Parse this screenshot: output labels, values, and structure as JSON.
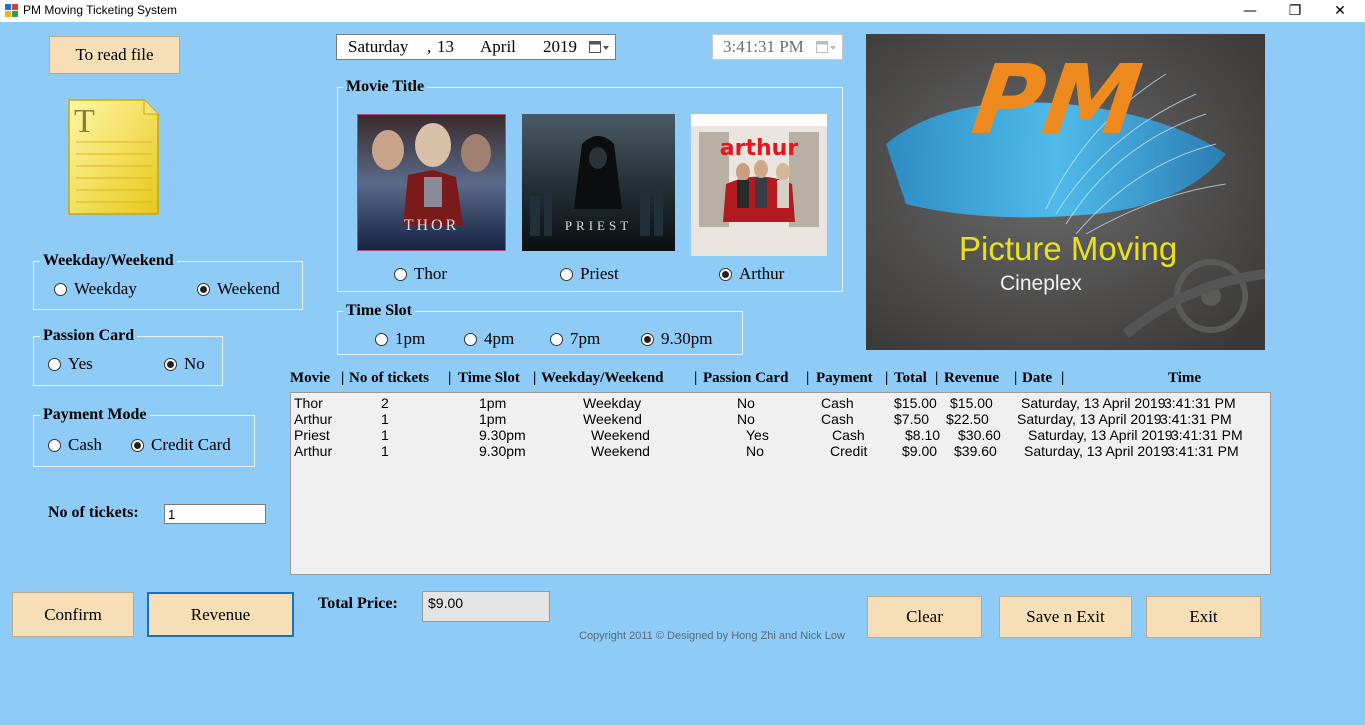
{
  "window": {
    "title": "PM Moving Ticketing System",
    "minimize": "—",
    "maximize": "❐",
    "close": "✕"
  },
  "read_file_button": "To read file",
  "date_picker": {
    "weekday": "Saturday",
    "sep": ",",
    "day": "13",
    "month": "April",
    "year": "2019"
  },
  "time_picker": {
    "value": "3:41:31 PM"
  },
  "movie_title": {
    "label": "Movie Title",
    "options": [
      {
        "label": "Thor",
        "selected": false,
        "poster_text": "THOR"
      },
      {
        "label": "Priest",
        "selected": false,
        "poster_text": "PRIEST"
      },
      {
        "label": "Arthur",
        "selected": true,
        "poster_text": "arthur"
      }
    ]
  },
  "logo": {
    "line1": "Picture Moving",
    "line2": "Cineplex",
    "letters": "PM"
  },
  "weekday_group": {
    "label": "Weekday/Weekend",
    "options": [
      {
        "label": "Weekday",
        "selected": false
      },
      {
        "label": "Weekend",
        "selected": true
      }
    ]
  },
  "passion_card_group": {
    "label": "Passion Card",
    "options": [
      {
        "label": "Yes",
        "selected": false
      },
      {
        "label": "No",
        "selected": true
      }
    ]
  },
  "payment_group": {
    "label": "Payment Mode",
    "options": [
      {
        "label": "Cash",
        "selected": false
      },
      {
        "label": "Credit Card",
        "selected": true
      }
    ]
  },
  "time_slot_group": {
    "label": "Time Slot",
    "options": [
      {
        "label": "1pm",
        "selected": false
      },
      {
        "label": "4pm",
        "selected": false
      },
      {
        "label": "7pm",
        "selected": false
      },
      {
        "label": "9.30pm",
        "selected": true
      }
    ]
  },
  "tickets": {
    "label": "No of tickets:",
    "value": "1"
  },
  "table": {
    "headers": [
      "Movie",
      "No of tickets",
      "Time Slot",
      "Weekday/Weekend",
      "Passion Card",
      "Payment",
      "Total",
      "Revenue",
      "Date",
      "Time"
    ],
    "separator": "|",
    "rows": [
      [
        "Thor",
        "2",
        "1pm",
        "Weekday",
        "No",
        "Cash",
        "$15.00",
        "$15.00",
        "Saturday, 13 April 2019",
        "3:41:31 PM"
      ],
      [
        "Arthur",
        "1",
        "1pm",
        "Weekend",
        "No",
        "Cash",
        "$7.50",
        "$22.50",
        "Saturday, 13 April 2019",
        "3:41:31 PM"
      ],
      [
        "Priest",
        "1",
        "9.30pm",
        "Weekend",
        "Yes",
        "Cash",
        "$8.10",
        "$30.60",
        "Saturday, 13 April 2019",
        "3:41:31 PM"
      ],
      [
        "Arthur",
        "1",
        "9.30pm",
        "Weekend",
        "No",
        "Credit",
        "$9.00",
        "$39.60",
        "Saturday, 13 April 2019",
        "3:41:31 PM"
      ]
    ]
  },
  "buttons": {
    "confirm": "Confirm",
    "revenue": "Revenue",
    "clear": "Clear",
    "save_exit": "Save n Exit",
    "exit": "Exit"
  },
  "total_price": {
    "label": "Total Price:",
    "value": "$9.00"
  },
  "copyright": "Copyright 2011 © Designed by Hong Zhi and Nick Low"
}
